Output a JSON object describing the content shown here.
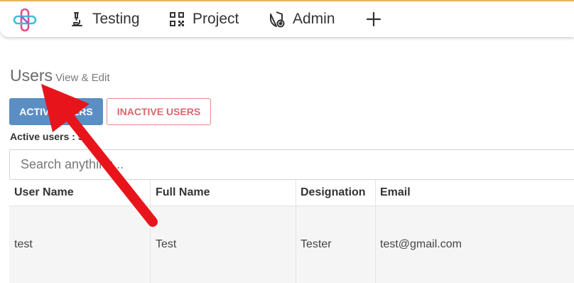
{
  "nav": {
    "items": [
      {
        "label": "Testing",
        "icon": "microscope-icon"
      },
      {
        "label": "Project",
        "icon": "qr-code-icon"
      },
      {
        "label": "Admin",
        "icon": "shield-gear-icon"
      }
    ],
    "add_icon": "plus-icon"
  },
  "page": {
    "title": "Users",
    "subtitle": "View & Edit"
  },
  "tabs": {
    "active_label": "ACTIVE USERS",
    "inactive_label": "INACTIVE USERS"
  },
  "count_text": "Active users : 53",
  "search": {
    "placeholder": "Search anything..."
  },
  "table": {
    "headers": [
      "User Name",
      "Full Name",
      "Designation",
      "Email"
    ],
    "rows": [
      [
        "test",
        "Test",
        "Tester",
        "test@gmail.com"
      ]
    ]
  },
  "colors": {
    "accent_blue": "#5b8fc4",
    "inactive_red": "#d9666f",
    "annotation_arrow": "#e8141b"
  }
}
